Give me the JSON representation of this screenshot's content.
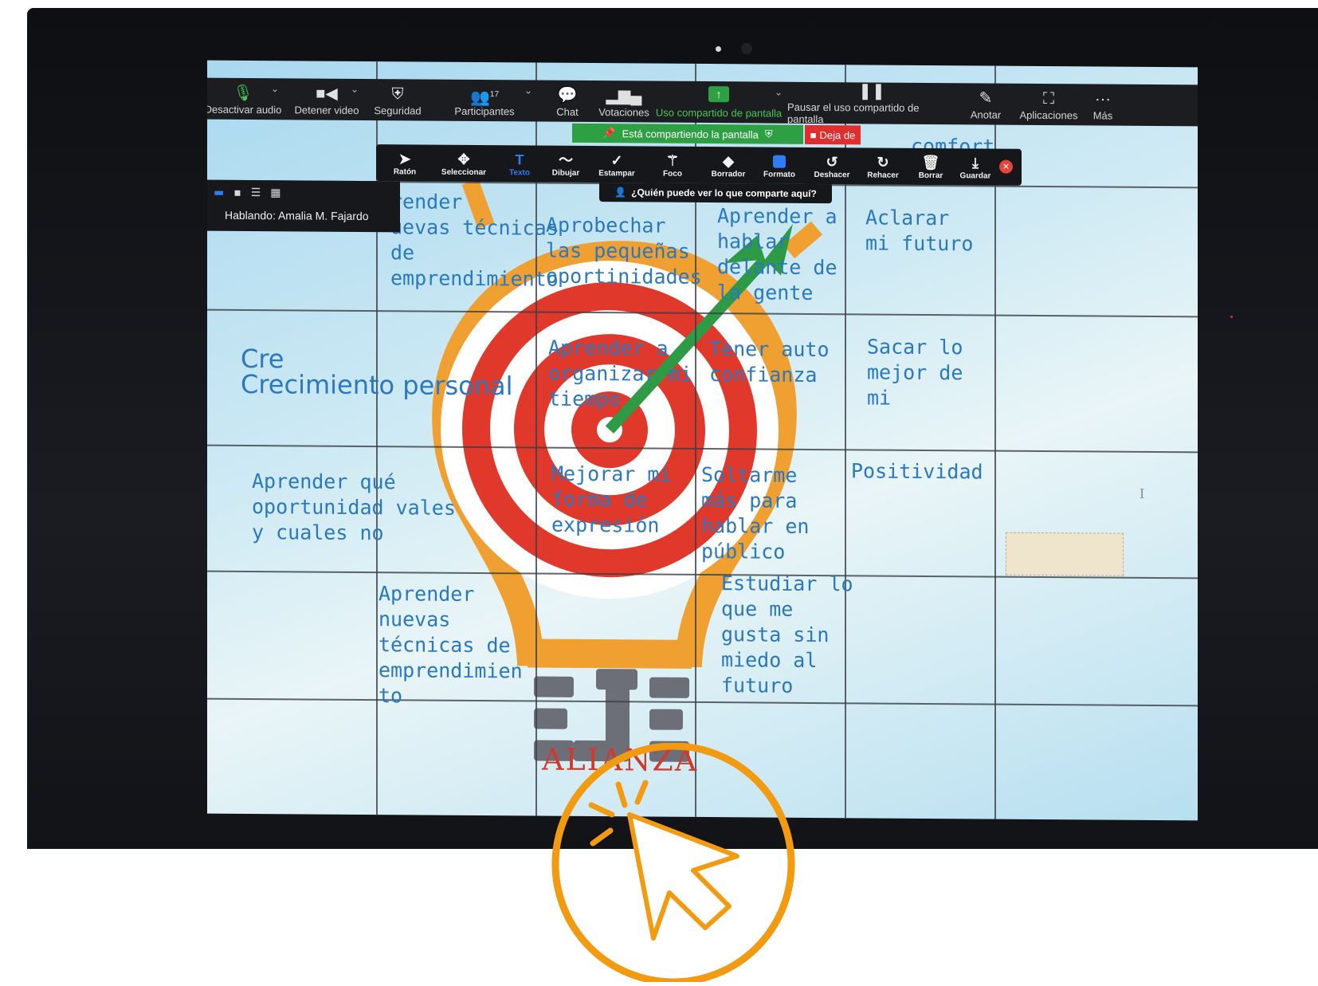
{
  "zoom_toolbar": {
    "mute": "Desactivar audio",
    "stop_video": "Detener video",
    "security": "Seguridad",
    "participants": "Participantes",
    "participants_count": "17",
    "chat": "Chat",
    "polls": "Votaciones",
    "share": "Uso compartido de pantalla",
    "pause_share": "Pausar el uso compartido de pantalla",
    "annotate": "Anotar",
    "apps": "Aplicaciones",
    "more": "Más"
  },
  "sharing_banner": {
    "text": "Está compartiendo la pantalla",
    "stop": "Deja de"
  },
  "annotation_toolbar": {
    "mouse": "Ratón",
    "select": "Seleccionar",
    "text": "Texto",
    "draw": "Dibujar",
    "stamp": "Estampar",
    "spotlight": "Foco",
    "eraser": "Borrador",
    "format": "Formato",
    "undo": "Deshacer",
    "redo": "Rehacer",
    "clear": "Borrar",
    "save": "Guardar"
  },
  "who_can_see": "¿Quién puede ver lo que comparte aquí?",
  "speaker_panel": {
    "speaking": "Hablando: Amalia M. Fajardo"
  },
  "board": {
    "partial_top": "comfort",
    "cells": [
      "render\nuevas técnicas\nde\nemprendimiento",
      "Aprobechar\nlas pequeñas\noportinidades",
      "Aprender a\nhablar\ndelante de\nla gente",
      "Aclarar\nmi futuro",
      "Cre\nCrecimiento personal",
      "Aprender a\norganizar mi\ntiempo",
      "Tener auto\nconfianza",
      "Sacar lo\nmejor de\nmi",
      "Aprender qué\noportunidad vales\ny cuales no",
      "Mejorar mi\nforma de\nexpresión",
      "Soltarme\nmás para\nhablar en\npúblico",
      "Positividad",
      "Aprender\nnuevas\ntécnicas de\nemprendimien\nto",
      "Estudiar lo\nque me\ngusta sin\nmiedo al\nfuturo"
    ],
    "logo_text": "ALIANZA",
    "logo_letters": "EJE"
  },
  "colors": {
    "bulb": "#f0a030",
    "target_red": "#e0392b",
    "arrow": "#2e9a45",
    "text_blue": "#2a78c0",
    "accent_orange": "#f29a10"
  },
  "icons": [
    "mic-icon",
    "video-icon",
    "shield-icon",
    "participants-icon",
    "chat-icon",
    "polls-icon",
    "share-screen-icon",
    "pause-icon",
    "annotate-icon",
    "apps-icon",
    "more-icon",
    "cursor-click-icon"
  ]
}
